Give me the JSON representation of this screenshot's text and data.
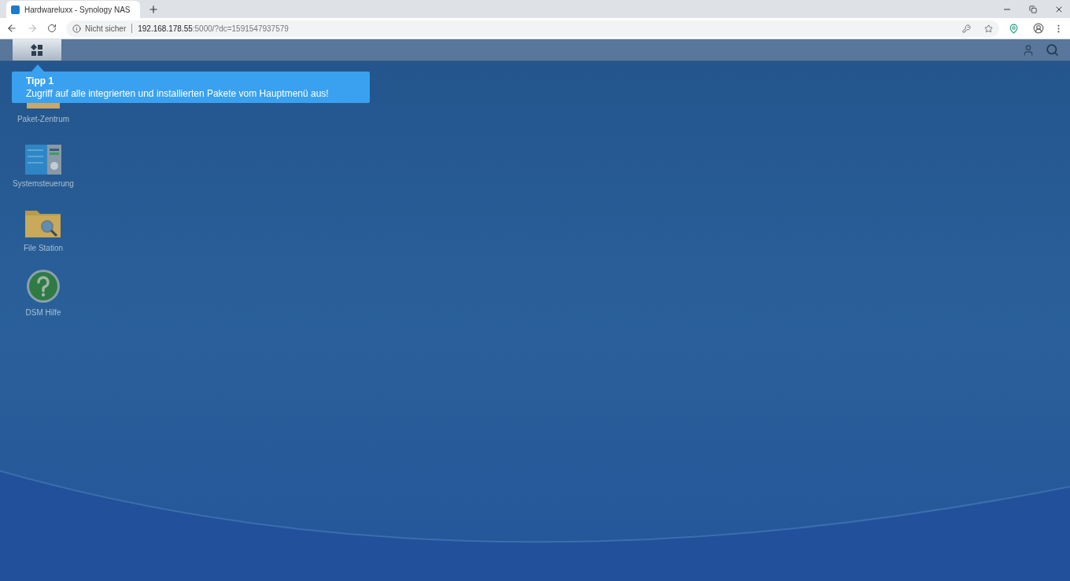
{
  "browser": {
    "tab": {
      "title": "Hardwareluxx - Synology NAS",
      "selected": true
    },
    "address": {
      "security": "Nicht sicher",
      "host": "192.168.178.55",
      "rest": ":5000/?dc=1591547937579"
    }
  },
  "taskbar": {
    "main_menu": {
      "selected": true
    }
  },
  "tooltip": {
    "title": "Tipp 1",
    "text": "Zugriff auf alle integrierten und installierten Pakete vom Hauptmenü aus!"
  },
  "desktop_icons": [
    {
      "kind": "package",
      "label": "Paket-Zentrum"
    },
    {
      "kind": "control-panel",
      "label": "Systemsteuerung"
    },
    {
      "kind": "folder",
      "label": "File Station"
    },
    {
      "kind": "help",
      "label": "DSM Hilfe"
    }
  ]
}
